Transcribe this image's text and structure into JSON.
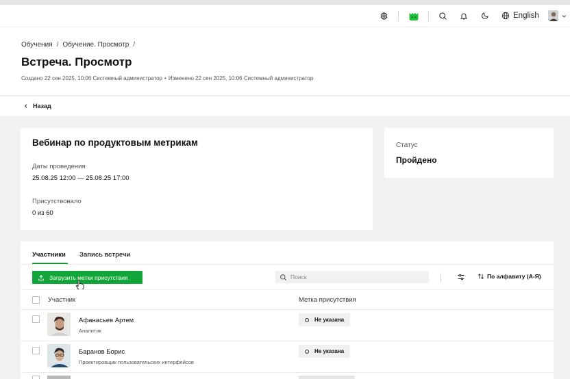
{
  "topbar": {
    "icons": [
      "gear-icon",
      "app-logo-icon",
      "search-icon",
      "bell-icon",
      "moon-icon",
      "globe-icon",
      "chevron-down-icon"
    ],
    "language": "English"
  },
  "breadcrumbs": [
    "Обучения",
    "Обучение. Просмотр"
  ],
  "breadcrumb_separator": "/",
  "page_title": "Встреча. Просмотр",
  "meta": {
    "created": "Создано 22 сен 2025, 10:06 Системный администратор",
    "bullet": "•",
    "modified": "Изменено 22 сен 2025, 10:06 Системный администратор"
  },
  "back_label": "Назад",
  "event": {
    "title": "Вебинар по продуктовым метрикам",
    "dates_label": "Даты проведения",
    "dates_value": "25.08.25 12:00 — 25.08.25 17:00",
    "attended_label": "Присутствовало",
    "attended_value": "0 из 60"
  },
  "status": {
    "label": "Статус",
    "value": "Пройдено"
  },
  "tabs": [
    {
      "label": "Участники",
      "active": true
    },
    {
      "label": "Запись встречи",
      "active": false
    }
  ],
  "toolbar": {
    "upload_label": "Загрузить метки присутствия",
    "search_placeholder": "Поиск",
    "sort_label": "По алфавиту (А-Я)"
  },
  "table": {
    "columns": [
      "Участник",
      "Метка присутствия"
    ],
    "rows": [
      {
        "name": "Афанасьев Артем",
        "role": "Аналитик",
        "mark": "Не указана"
      },
      {
        "name": "Баранов Борис",
        "role": "Проектировщик пользовательских интерфейсов",
        "mark": "Не указана"
      }
    ]
  },
  "colors": {
    "accent": "#12a53a",
    "logo": "#1fbf3a",
    "background": "#f2f2f2"
  }
}
